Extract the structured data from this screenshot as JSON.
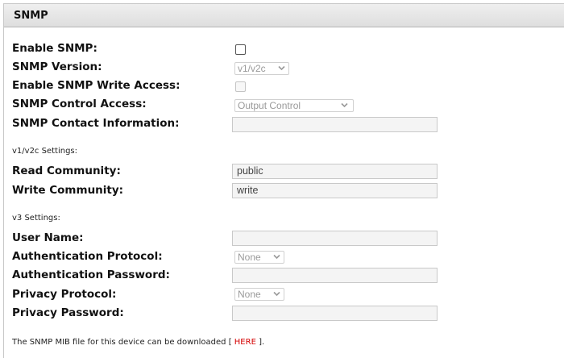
{
  "panel": {
    "title": "SNMP"
  },
  "general": {
    "enable_snmp_label": "Enable SNMP:",
    "snmp_version_label": "SNMP Version:",
    "snmp_version_value": "v1/v2c",
    "enable_write_label": "Enable SNMP Write Access:",
    "control_access_label": "SNMP Control Access:",
    "control_access_value": "Output Control",
    "contact_label": "SNMP Contact Information:",
    "contact_value": ""
  },
  "v1v2c": {
    "section_label": "v1/v2c Settings:",
    "read_label": "Read Community:",
    "read_value": "public",
    "write_label": "Write Community:",
    "write_value": "write"
  },
  "v3": {
    "section_label": "v3 Settings:",
    "user_label": "User Name:",
    "user_value": "",
    "auth_protocol_label": "Authentication Protocol:",
    "auth_protocol_value": "None",
    "auth_password_label": "Authentication Password:",
    "auth_password_value": "",
    "privacy_protocol_label": "Privacy Protocol:",
    "privacy_protocol_value": "None",
    "privacy_password_label": "Privacy Password:",
    "privacy_password_value": ""
  },
  "footer": {
    "text_before": "The SNMP MIB file for this device can be downloaded [ ",
    "link_label": "HERE",
    "text_after": " ]."
  },
  "icons": {
    "dropdown": "chevron-down-icon"
  },
  "colors": {
    "link": "#d40000",
    "header_bg": "#e4e4e4"
  }
}
